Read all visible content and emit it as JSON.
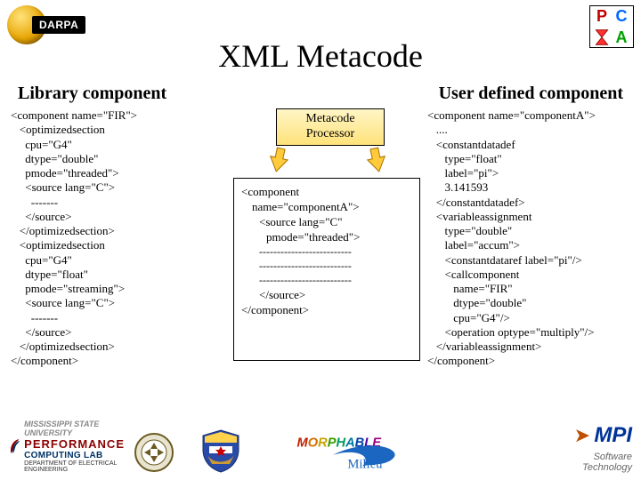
{
  "logos": {
    "darpa": "DARPA",
    "pca": {
      "P": "P",
      "C": "C",
      "A": "A"
    },
    "perf": {
      "l1": "MISSISSIPPI STATE UNIVERSITY",
      "l2": "PERFORMANCE",
      "l3": "COMPUTING LAB",
      "l4": "DEPARTMENT OF ELECTRICAL ENGINEERING"
    },
    "morph": {
      "word": "MORPHABLE",
      "sub": "Milieu"
    },
    "mpi": {
      "top": "MPI",
      "bot": "Software\nTechnology"
    }
  },
  "title": "XML Metacode",
  "columns": {
    "left": "Library component",
    "right": "User defined component"
  },
  "processor": {
    "l1": "Metacode",
    "l2": "Processor"
  },
  "code_left": "<component name=\"FIR\">\n   <optimizedsection\n     cpu=\"G4\"\n     dtype=\"double\"\n     pmode=\"threaded\">\n     <source lang=\"C\">\n       -------\n     </source>\n   </optimizedsection>\n   <optimizedsection\n     cpu=\"G4\"\n     dtype=\"float\"\n     pmode=\"streaming\">\n     <source lang=\"C\">\n       -------\n     </source>\n   </optimizedsection>\n</component>",
  "code_right": "<component name=\"componentA\">\n   ....\n   <constantdatadef\n      type=\"float\"\n      label=\"pi\">\n      3.141593\n   </constantdatadef>\n   <variableassignment\n      type=\"double\"\n      label=\"accum\">\n      <constantdataref label=\"pi\"/>\n      <callcomponent\n         name=\"FIR\"\n         dtype=\"double\"\n         cpu=\"G4\"/>\n      <operation optype=\"multiply\"/>\n   </variableassignment>\n</component>",
  "generated": {
    "l0": "<component",
    "l1": "name=\"componentA\">",
    "l2": "<source lang=\"C\"",
    "l3": "pmode=\"threaded\">",
    "d": "--------------------------",
    "l4": "</source>",
    "l5": "</component>"
  }
}
